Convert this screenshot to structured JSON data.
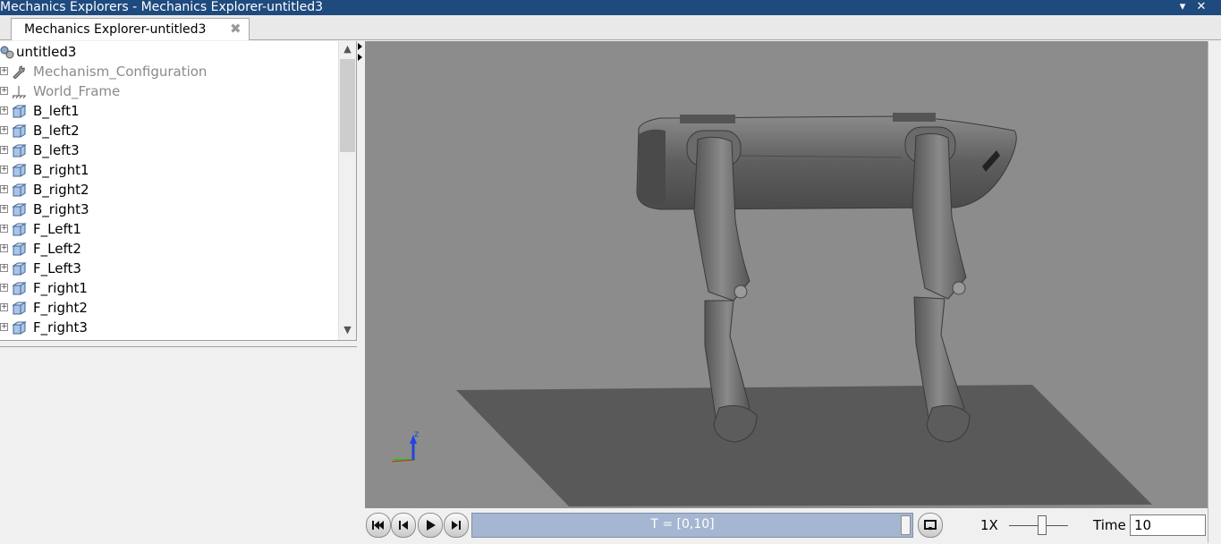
{
  "window": {
    "title": "Mechanics Explorers - Mechanics Explorer-untitled3",
    "menu_glyph": "▾",
    "close_glyph": "✕"
  },
  "tab": {
    "label": "Mechanics Explorer-untitled3",
    "close_glyph": "✖"
  },
  "tree": {
    "root": "untitled3",
    "items": [
      {
        "label": "Mechanism_Configuration",
        "icon": "wrench-icon",
        "grey": true
      },
      {
        "label": "World_Frame",
        "icon": "world-frame-icon",
        "grey": true
      },
      {
        "label": "B_left1",
        "icon": "solid-body-icon",
        "grey": false
      },
      {
        "label": "B_left2",
        "icon": "solid-body-icon",
        "grey": false
      },
      {
        "label": "B_left3",
        "icon": "solid-body-icon",
        "grey": false
      },
      {
        "label": "B_right1",
        "icon": "solid-body-icon",
        "grey": false
      },
      {
        "label": "B_right2",
        "icon": "solid-body-icon",
        "grey": false
      },
      {
        "label": "B_right3",
        "icon": "solid-body-icon",
        "grey": false
      },
      {
        "label": "F_Left1",
        "icon": "solid-body-icon",
        "grey": false
      },
      {
        "label": "F_Left2",
        "icon": "solid-body-icon",
        "grey": false
      },
      {
        "label": "F_Left3",
        "icon": "solid-body-icon",
        "grey": false
      },
      {
        "label": "F_right1",
        "icon": "solid-body-icon",
        "grey": false
      },
      {
        "label": "F_right2",
        "icon": "solid-body-icon",
        "grey": false
      },
      {
        "label": "F_right3",
        "icon": "solid-body-icon",
        "grey": false
      }
    ],
    "expander_glyph": "+"
  },
  "viewport": {
    "axis_label_z": "z",
    "background": "#8c8c8c",
    "ground_color": "#595959",
    "robot_color": "#6b6b6b"
  },
  "playback": {
    "timeline_label": "T = [0,10]",
    "timeline_progress": 1.0,
    "speed_label": "1X",
    "time_label": "Time",
    "time_value": "10",
    "buttons": [
      "skip-to-start",
      "step-back",
      "play",
      "step-forward",
      "loop"
    ]
  },
  "colors": {
    "titlebar": "#1e4a7e",
    "timeline_fill": "#a5b6d2",
    "tree_grey_text": "#8a8a8a"
  }
}
